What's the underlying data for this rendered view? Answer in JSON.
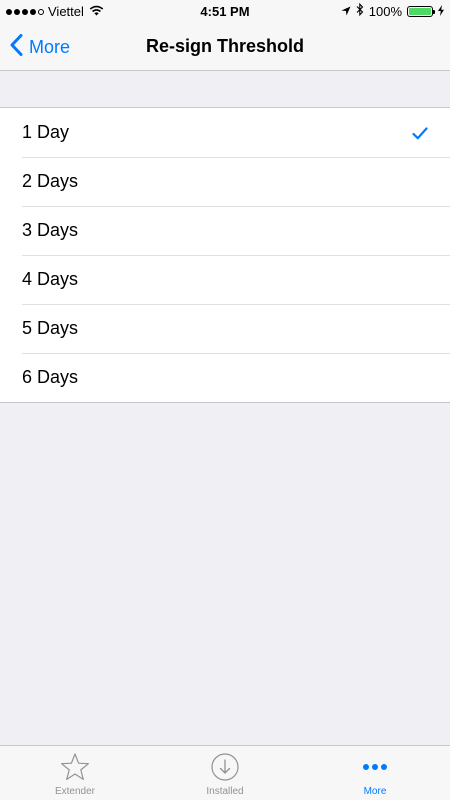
{
  "status_bar": {
    "carrier": "Viettel",
    "time": "4:51 PM",
    "battery": "100%",
    "battery_color": "#4cd964"
  },
  "nav": {
    "back_label": "More",
    "title": "Re-sign Threshold"
  },
  "options": [
    {
      "label": "1 Day",
      "selected": true
    },
    {
      "label": "2 Days",
      "selected": false
    },
    {
      "label": "3 Days",
      "selected": false
    },
    {
      "label": "4 Days",
      "selected": false
    },
    {
      "label": "5 Days",
      "selected": false
    },
    {
      "label": "6 Days",
      "selected": false
    }
  ],
  "tabs": [
    {
      "label": "Extender",
      "icon": "star-icon",
      "active": false
    },
    {
      "label": "Installed",
      "icon": "download-circle-icon",
      "active": false
    },
    {
      "label": "More",
      "icon": "more-dots-icon",
      "active": true
    }
  ],
  "colors": {
    "accent": "#007aff",
    "background": "#efeff4",
    "inactive": "#929292"
  }
}
